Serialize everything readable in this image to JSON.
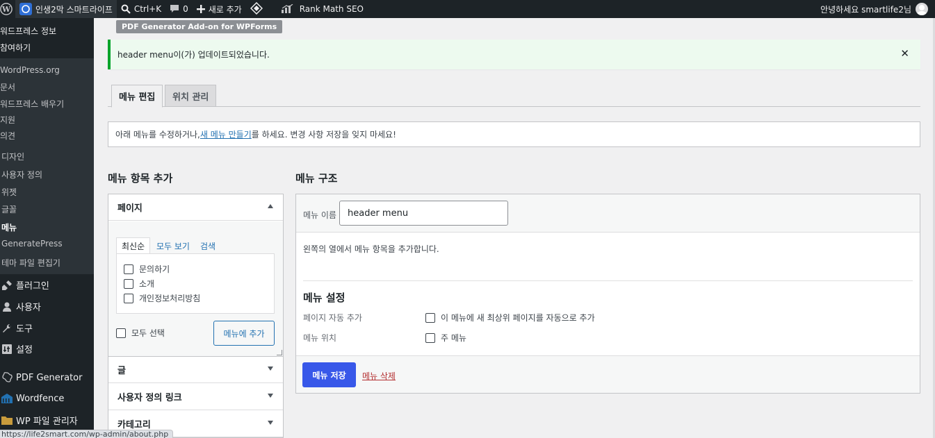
{
  "admin_bar": {
    "site_name": "인생2막 스마트라이프",
    "search_shortcut": "Ctrl+K",
    "comments_count": "0",
    "new_label": "새로 추가",
    "rank_math": "Rank Math SEO",
    "greeting": "안녕하세요 smartlife2님"
  },
  "sidebar": {
    "about_items": [
      "워드프레스 정보",
      "참여하기"
    ],
    "wp_links": [
      "WordPress.org",
      "문서",
      "워드프레스 배우기",
      "지원",
      "의견"
    ],
    "appearance_items": [
      "디자인",
      "사용자 정의",
      "위젯",
      "글꼴",
      "메뉴",
      "GeneratePress",
      "테마 파일 편집기"
    ],
    "active_item": "메뉴",
    "main_items": [
      "플러그인",
      "사용자",
      "도구",
      "설정",
      "PDF Generator",
      "Wordfence",
      "WP 파일 관리자"
    ]
  },
  "plugin_badge": "PDF Generator Add-on for WPForms",
  "notice": {
    "menu_name": "header menu",
    "text": "이(가) 업데이트되었습니다."
  },
  "tabs": [
    "메뉴 편집",
    "위치 관리"
  ],
  "info": {
    "before": "아래 메뉴를 수정하거나, ",
    "link": "새 메뉴 만들기",
    "after": "를 하세요. 변경 사항 저장을 잊지 마세요!"
  },
  "add_items": {
    "title": "메뉴 항목 추가",
    "sections": [
      "페이지",
      "글",
      "사용자 정의 링크",
      "카테고리"
    ],
    "subtabs": [
      "최신순",
      "모두 보기",
      "검색"
    ],
    "pages": [
      "문의하기",
      "소개",
      "개인정보처리방침"
    ],
    "select_all": "모두 선택",
    "add_button": "메뉴에 추가"
  },
  "structure": {
    "title": "메뉴 구조",
    "name_label": "메뉴 이름",
    "name_value": "header menu",
    "hint": "왼쪽의 열에서 메뉴 항목을 추가합니다.",
    "settings_title": "메뉴 설정",
    "auto_add_label": "페이지 자동 추가",
    "auto_add_option": "이 메뉴에 새 최상위 페이지를 자동으로 추가",
    "location_label": "메뉴 위치",
    "location_option": "주 메뉴",
    "save_button": "메뉴 저장",
    "delete_link": "메뉴 삭제"
  },
  "status_url": "https://life2smart.com/wp-admin/about.php",
  "colors": {
    "adminbar_bg": "#1d2327",
    "primary_button": "#3858e9",
    "link": "#2271b1",
    "notice_border": "#00a32a",
    "delete": "#b32d2e"
  }
}
